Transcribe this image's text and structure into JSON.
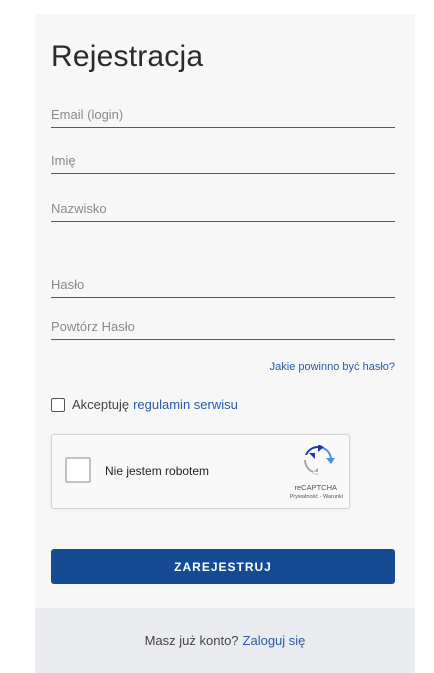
{
  "form": {
    "title": "Rejestracja",
    "fields": {
      "email_placeholder": "Email (login)",
      "first_name_placeholder": "Imię",
      "last_name_placeholder": "Nazwisko",
      "password_placeholder": "Hasło",
      "repeat_password_placeholder": "Powtórz Hasło"
    },
    "password_hint_link": "Jakie powinno być hasło?",
    "accept_prefix": "Akceptuję",
    "accept_link": "regulamin serwisu",
    "submit_label": "ZAREJESTRUJ"
  },
  "captcha": {
    "label": "Nie jestem robotem",
    "brand": "reCAPTCHA",
    "links": "Prywatność - Warunki",
    "icon": "recaptcha-logo-icon"
  },
  "footer": {
    "prompt": "Masz już konto?",
    "login_link": "Zaloguj się"
  },
  "colors": {
    "primary": "#144b93",
    "link": "#2a5aa8",
    "card_bg": "#f7f7f7",
    "footer_bg": "#e9ebef"
  }
}
